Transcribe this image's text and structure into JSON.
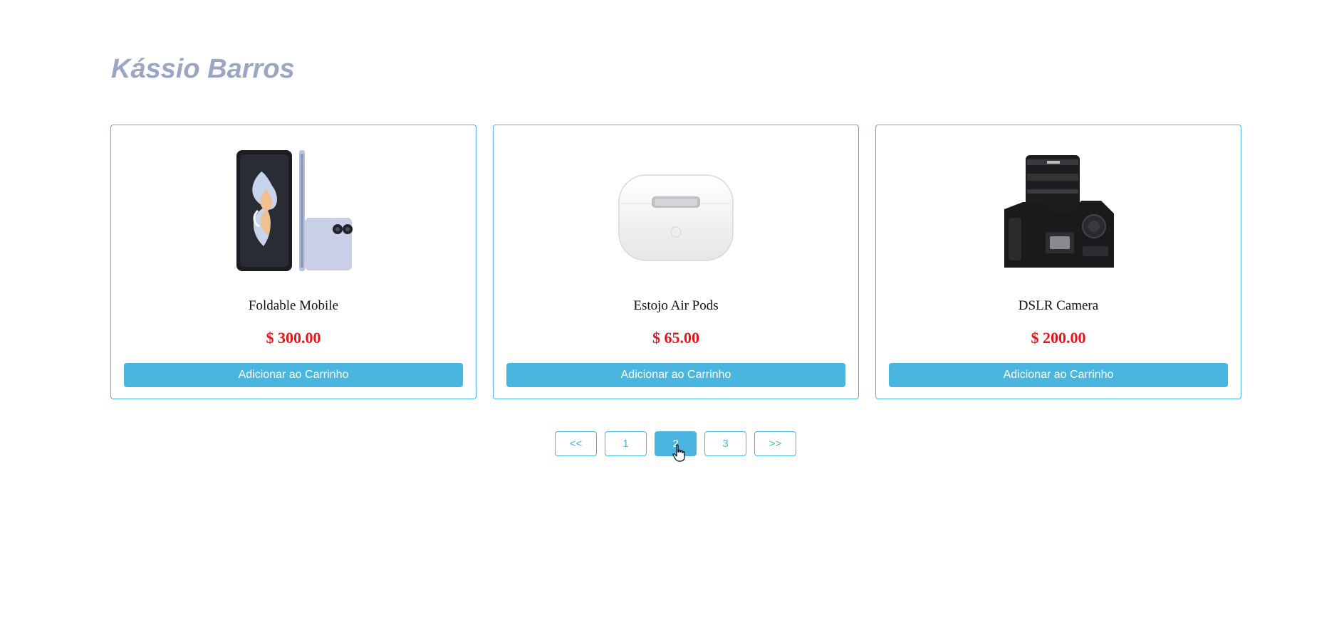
{
  "header": {
    "title": "Kássio Barros"
  },
  "products": [
    {
      "name": "Foldable Mobile",
      "price": "$ 300.00",
      "button_label": "Adicionar ao Carrinho",
      "image_icon": "foldable-phone-icon"
    },
    {
      "name": "Estojo Air Pods",
      "price": "$ 65.00",
      "button_label": "Adicionar ao Carrinho",
      "image_icon": "earbuds-case-icon"
    },
    {
      "name": "DSLR Camera",
      "price": "$ 200.00",
      "button_label": "Adicionar ao Carrinho",
      "image_icon": "camera-icon"
    }
  ],
  "pagination": {
    "prev_label": "<<",
    "pages": [
      "1",
      "2",
      "3"
    ],
    "next_label": ">>",
    "current_page": "2"
  },
  "colors": {
    "accent": "#4ab6e0",
    "price": "#e8141a",
    "title": "#9aa6c4"
  }
}
